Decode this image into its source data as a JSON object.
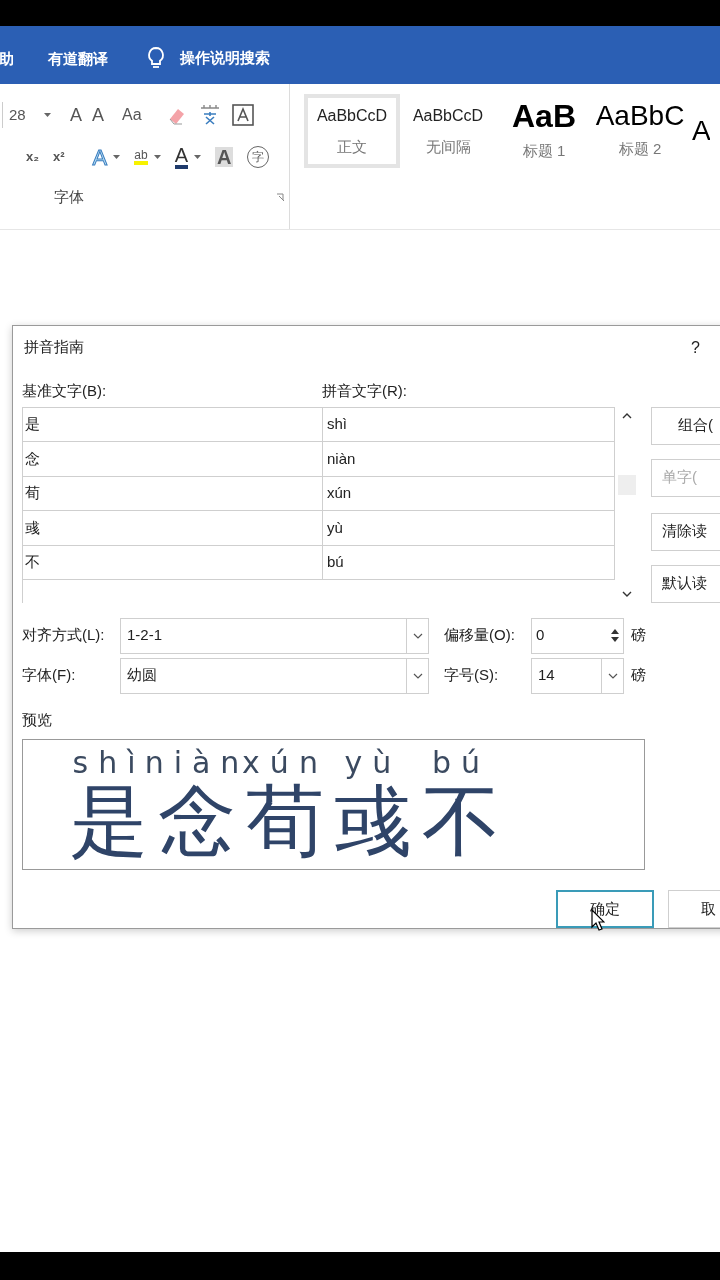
{
  "ribbon_tabs": [
    {
      "label": "助"
    },
    {
      "label": "有道翻译"
    },
    {
      "label": "操作说明搜索",
      "kind": "search"
    }
  ],
  "font_group": {
    "size": "28",
    "row1": [
      "A",
      "A",
      "Aa"
    ],
    "row2": [
      "x₂",
      "x²",
      "A",
      "ab",
      "A",
      "A",
      "字"
    ],
    "label": "字体"
  },
  "styles": [
    {
      "sample": "AaBbCcD",
      "name": "正文",
      "selected": true,
      "kind": "body"
    },
    {
      "sample": "AaBbCcD",
      "name": "无间隔",
      "selected": false,
      "kind": "body"
    },
    {
      "sample": "AaB",
      "name": "标题 1",
      "selected": false,
      "kind": "h1"
    },
    {
      "sample": "AaBbC",
      "name": "标题 2",
      "selected": false,
      "kind": "h2"
    },
    {
      "sample": "A",
      "selected": false,
      "kind": "h2"
    }
  ],
  "dialog": {
    "title": "拼音指南",
    "help": "?",
    "base_label": "基准文字(B):",
    "ruby_label": "拼音文字(R):",
    "rows": [
      {
        "base": "是",
        "ruby": "shì"
      },
      {
        "base": "念",
        "ruby": "niàn"
      },
      {
        "base": "荀",
        "ruby": "xún"
      },
      {
        "base": "彧",
        "ruby": "yù"
      },
      {
        "base": "不",
        "ruby": "bú"
      }
    ],
    "side_buttons": [
      {
        "label": "组合(",
        "disabled": false
      },
      {
        "label": "单字(",
        "disabled": true
      },
      {
        "label": "清除读",
        "disabled": false
      },
      {
        "label": "默认读",
        "disabled": false
      }
    ],
    "alignment": {
      "label": "对齐方式(L):",
      "value": "1-2-1"
    },
    "offset": {
      "label": "偏移量(O):",
      "value": "0",
      "unit": "磅"
    },
    "font": {
      "label": "字体(F):",
      "value": "幼圆"
    },
    "size": {
      "label": "字号(S):",
      "value": "14",
      "unit": "磅"
    },
    "preview_label": "预览",
    "preview": [
      {
        "ruby": "shì",
        "base": "是"
      },
      {
        "ruby": "niàn",
        "base": "念"
      },
      {
        "ruby": "xún",
        "base": "荀"
      },
      {
        "ruby": "yù",
        "base": "彧"
      },
      {
        "ruby": "bú",
        "base": "不"
      }
    ],
    "buttons": [
      {
        "label": "确定",
        "focused": true
      },
      {
        "label": "取",
        "focused": false
      }
    ]
  }
}
